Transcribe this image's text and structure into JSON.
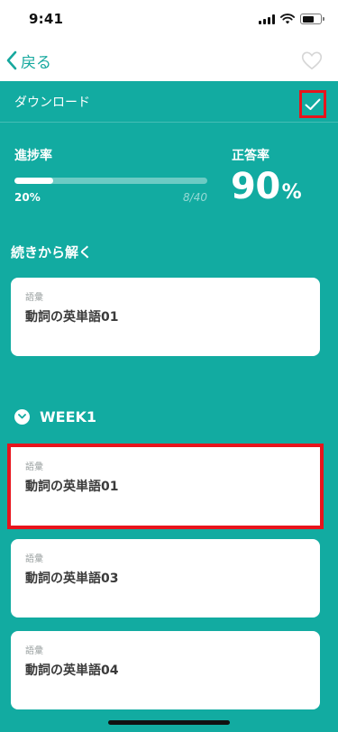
{
  "status_bar": {
    "time": "9:41"
  },
  "nav": {
    "back_label": "戻る"
  },
  "download": {
    "label": "ダウンロード"
  },
  "progress": {
    "label": "進捗率",
    "percent_text": "20%",
    "fraction": 0.2,
    "count_text": "8/40"
  },
  "accuracy": {
    "label": "正答率",
    "value": "90",
    "unit": "%"
  },
  "resume": {
    "title": "続きから解く",
    "card": {
      "category": "語彙",
      "title": "動詞の英単語01"
    }
  },
  "week": {
    "label": "WEEK1",
    "cards": [
      {
        "category": "語彙",
        "title": "動詞の英単語01"
      },
      {
        "category": "語彙",
        "title": "動詞の英単語03"
      },
      {
        "category": "語彙",
        "title": "動詞の英単語04"
      }
    ]
  },
  "colors": {
    "teal": "#12aba1",
    "accent_text": "#16a89e",
    "highlight_red": "#e8141c"
  }
}
